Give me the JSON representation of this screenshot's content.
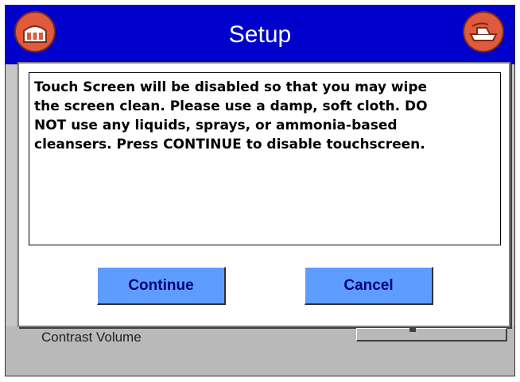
{
  "window": {
    "title": "Setup"
  },
  "icons": {
    "home": "home-building-icon",
    "exit": "exit-ship-icon"
  },
  "dialog": {
    "message": "Touch Screen will be disabled so that you may wipe\nthe screen clean. Please use a damp, soft cloth. DO\nNOT use any liquids, sprays, or ammonia-based\ncleansers. Press CONTINUE to disable touchscreen.",
    "continue_label": "Continue",
    "cancel_label": "Cancel"
  },
  "background": {
    "contrast_label": "Contrast Volume"
  },
  "colors": {
    "title_bar": "#0000cc",
    "button_fill": "#5f9cff",
    "button_text": "#000080",
    "icon_fill": "#e05a3c"
  }
}
